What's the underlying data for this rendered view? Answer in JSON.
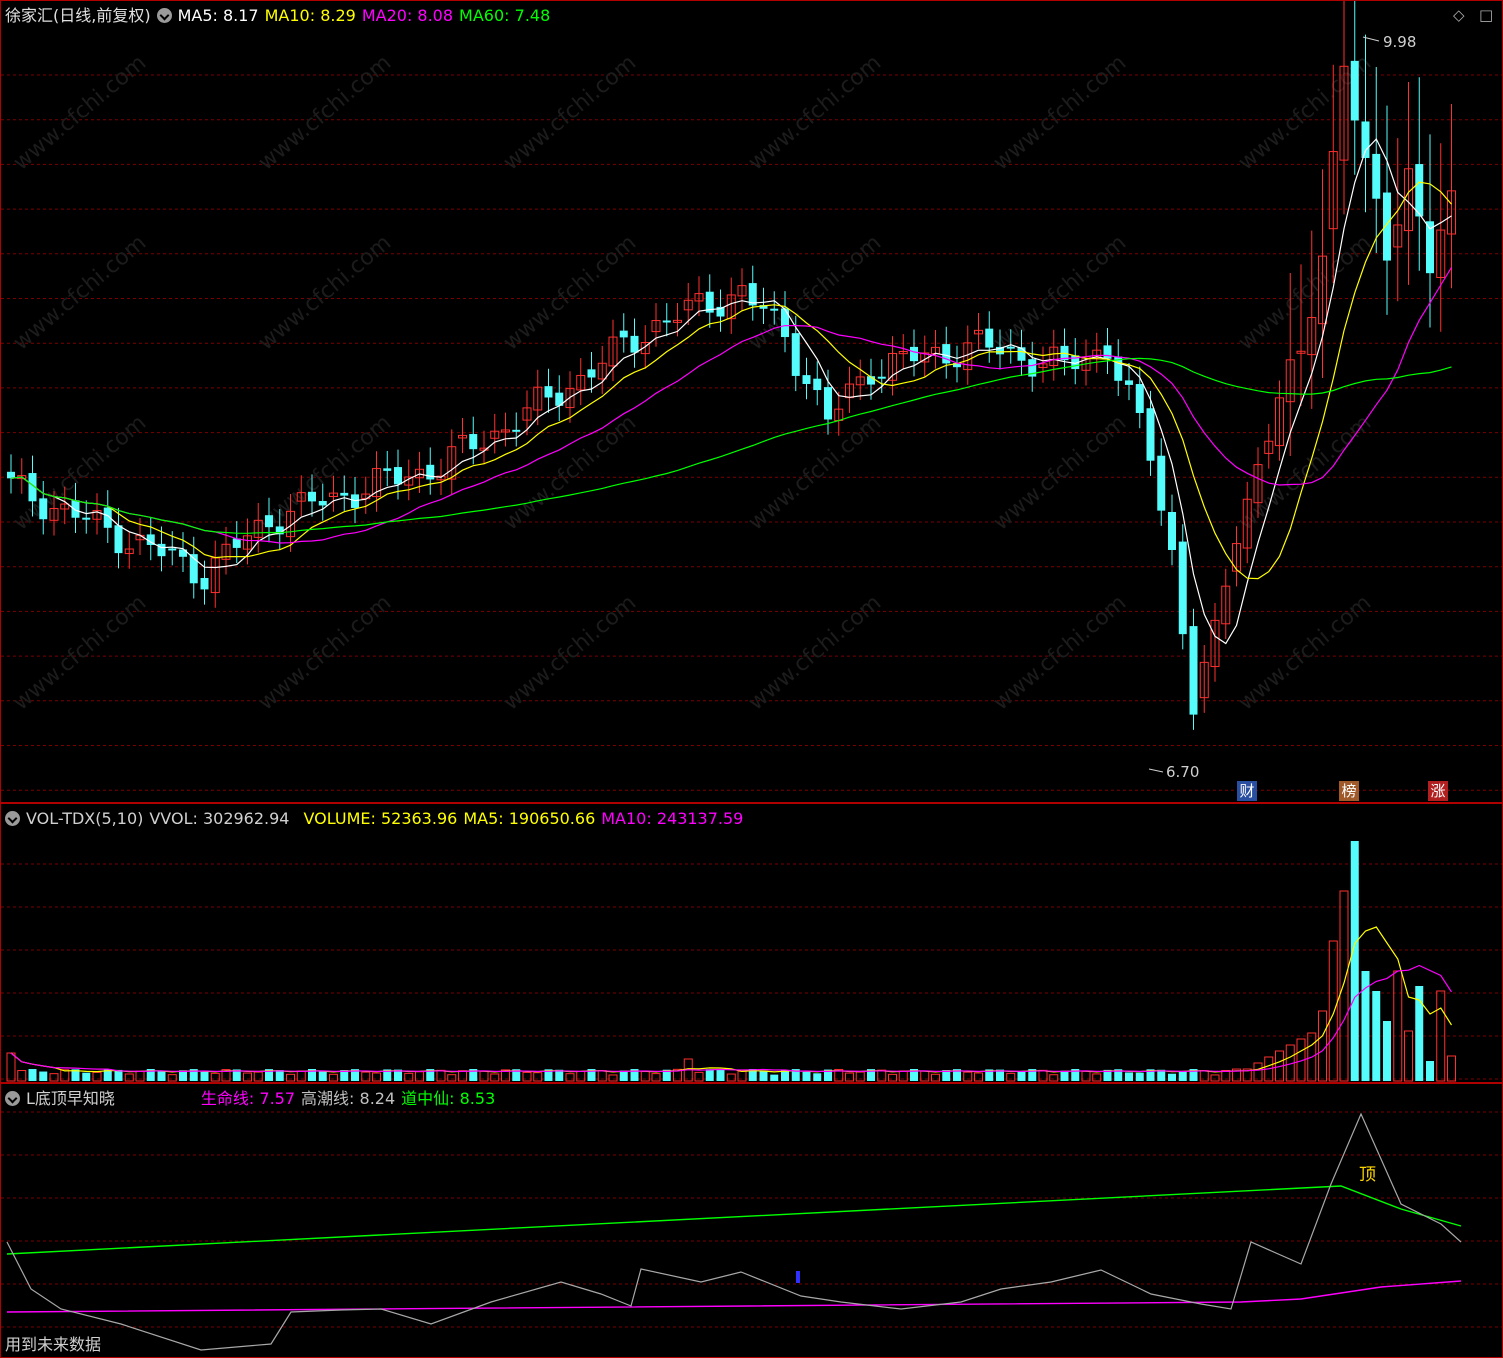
{
  "main": {
    "title": "徐家汇(日线,前复权)",
    "ma": [
      {
        "label": "MA5: 8.17",
        "color": "#ffffff"
      },
      {
        "label": "MA10: 8.29",
        "color": "#ffff00"
      },
      {
        "label": "MA20: 8.08",
        "color": "#ff00ff"
      },
      {
        "label": "MA60: 7.48",
        "color": "#00ff00"
      }
    ],
    "high_label": "9.98",
    "low_label": "6.70",
    "tags": [
      {
        "text": "财",
        "bg": "#2a4fa0"
      },
      {
        "text": "榜",
        "bg": "#a05a2a"
      },
      {
        "text": "涨",
        "bg": "#b02020"
      }
    ],
    "corner_icons": [
      "diamond-icon",
      "square-icon"
    ],
    "watermark": "www.cfchi.com"
  },
  "volume": {
    "name": "VOL-TDX(5,10)",
    "vvol": "VVOL: 302962.94",
    "volume": "VOLUME: 52363.96",
    "ma5": "MA5: 190650.66",
    "ma10": "MA10: 243137.59",
    "colors": {
      "vvol": "#d0d0d0",
      "volume": "#ffff00",
      "ma5": "#ffff00",
      "ma10": "#ff00ff"
    }
  },
  "indicator": {
    "name": "L底顶早知晓",
    "life_line": "生命线: 7.57",
    "tide_line": "高潮线: 8.24",
    "middle_line": "道中仙: 8.53",
    "top_mark": "顶",
    "footer": "用到未来数据",
    "colors": {
      "life": "#ff00ff",
      "tide": "#c0c0c0",
      "middle": "#00ff00"
    }
  },
  "colors": {
    "up": "#ff3030",
    "down": "#54fcfc",
    "grid": "#7a0000",
    "border": "#b00000"
  }
}
